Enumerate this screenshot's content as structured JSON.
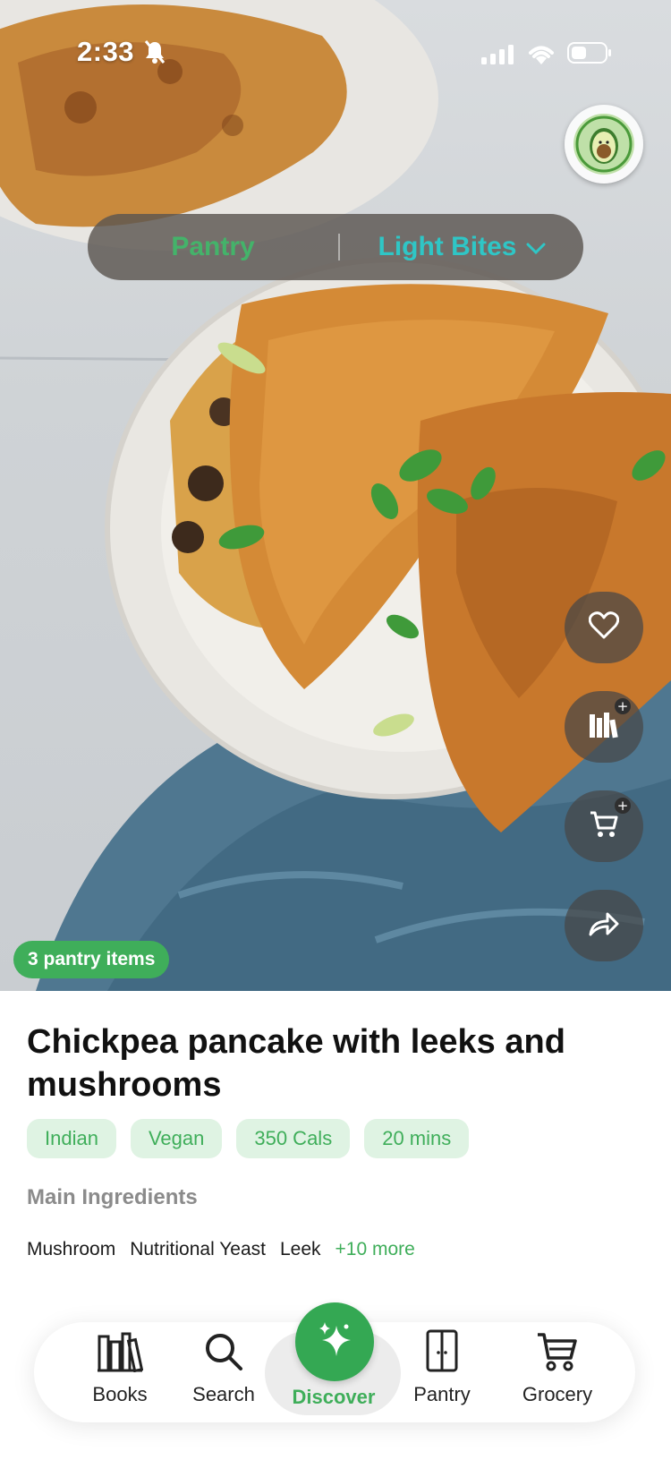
{
  "status_bar": {
    "time": "2:33"
  },
  "category_selector": {
    "left_label": "Pantry",
    "right_label": "Light Bites"
  },
  "badge": {
    "pantry_items": "3 pantry items"
  },
  "recipe": {
    "title": "Chickpea pancake with leeks and mushrooms",
    "tags": [
      "Indian",
      "Vegan",
      "350 Cals",
      "20 mins"
    ],
    "section_label": "Main Ingredients",
    "ingredients": [
      "Mushroom",
      "Nutritional Yeast",
      "Leek"
    ],
    "more_label": "+10 more"
  },
  "nav": {
    "items": [
      {
        "label": "Books",
        "icon": "books-icon"
      },
      {
        "label": "Search",
        "icon": "search-icon"
      },
      {
        "label": "Discover",
        "icon": "sparkles-icon",
        "active": true
      },
      {
        "label": "Pantry",
        "icon": "pantry-icon"
      },
      {
        "label": "Grocery",
        "icon": "cart-icon"
      }
    ]
  },
  "colors": {
    "accent_green": "#3fae5a",
    "teal": "#2fc6c6"
  }
}
